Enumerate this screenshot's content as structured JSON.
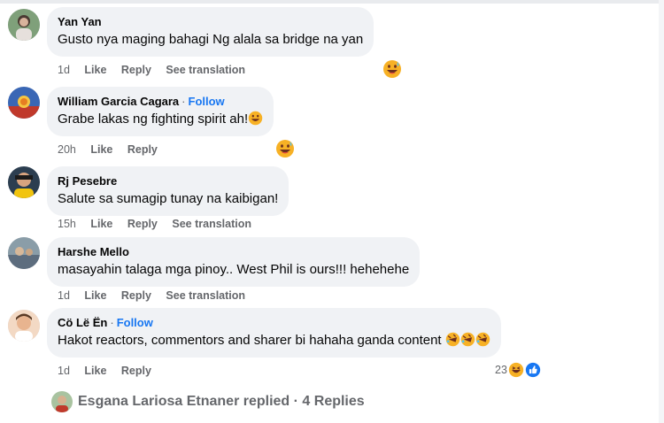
{
  "comments": [
    {
      "author": "Yan Yan",
      "follow": "",
      "text": "Gusto nya maging bahagi Ng alala sa bridge na yan",
      "time": "1d",
      "like": "Like",
      "reply": "Reply",
      "translate": "See translation",
      "reaction": "grin-sweat-icon"
    },
    {
      "author": "William Garcia Cagara",
      "follow": "Follow",
      "text": "Grabe lakas ng fighting spirit ah!",
      "time": "20h",
      "like": "Like",
      "reply": "Reply",
      "translate": "",
      "reaction": "grin-sweat-icon"
    },
    {
      "author": "Rj Pesebre",
      "follow": "",
      "text": "Salute sa sumagip tunay na kaibigan!",
      "time": "15h",
      "like": "Like",
      "reply": "Reply",
      "translate": "See translation",
      "reaction": ""
    },
    {
      "author": "Harshe Mello",
      "follow": "",
      "text": "masayahin talaga mga pinoy.. West Phil is ours!!! hehehehe",
      "time": "1d",
      "like": "Like",
      "reply": "Reply",
      "translate": "See translation",
      "reaction": ""
    },
    {
      "author": "Cö Lë Ën",
      "follow": "Follow",
      "text": "Hakot reactors, commentors and sharer bi hahaha ganda content",
      "time": "1d",
      "like": "Like",
      "reply": "Reply",
      "translate": "",
      "reaction_count": "23",
      "reaction_icons": [
        "haha-icon",
        "like-icon"
      ]
    }
  ],
  "replies": {
    "text": "Esgana Lariosa Etnaner replied · 4 Replies"
  },
  "colors": {
    "bubble": "#f0f2f5",
    "link_blue": "#1877f2",
    "secondary_text": "#65676b",
    "emoji_yellow": "#f7b125"
  }
}
